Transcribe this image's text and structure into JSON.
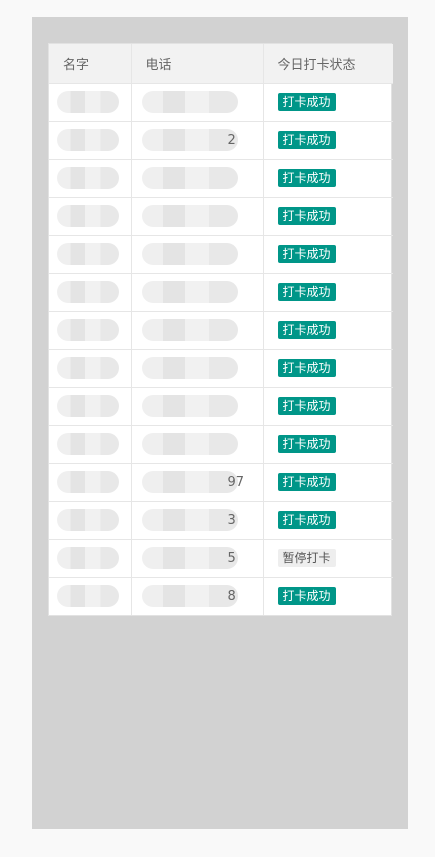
{
  "table": {
    "headers": {
      "name": "名字",
      "phone": "电话",
      "status": "今日打卡状态"
    },
    "rows": [
      {
        "phone_tail": "",
        "status": "打卡成功",
        "status_type": "ok"
      },
      {
        "phone_tail": "2",
        "status": "打卡成功",
        "status_type": "ok"
      },
      {
        "phone_tail": "",
        "status": "打卡成功",
        "status_type": "ok"
      },
      {
        "phone_tail": "",
        "status": "打卡成功",
        "status_type": "ok"
      },
      {
        "phone_tail": "",
        "status": "打卡成功",
        "status_type": "ok"
      },
      {
        "phone_tail": "",
        "status": "打卡成功",
        "status_type": "ok"
      },
      {
        "phone_tail": "",
        "status": "打卡成功",
        "status_type": "ok"
      },
      {
        "phone_tail": "",
        "status": "打卡成功",
        "status_type": "ok"
      },
      {
        "phone_tail": "",
        "status": "打卡成功",
        "status_type": "ok"
      },
      {
        "phone_tail": "",
        "status": "打卡成功",
        "status_type": "ok"
      },
      {
        "phone_tail": "97",
        "status": "打卡成功",
        "status_type": "ok"
      },
      {
        "phone_tail": "3",
        "status": "打卡成功",
        "status_type": "ok"
      },
      {
        "phone_tail": "5",
        "status": "暂停打卡",
        "status_type": "pause"
      },
      {
        "phone_tail": "8",
        "status": "打卡成功",
        "status_type": "ok"
      }
    ]
  },
  "colors": {
    "success": "#009688",
    "paused_bg": "#eeeeee",
    "frame": "#d2d2d2"
  }
}
